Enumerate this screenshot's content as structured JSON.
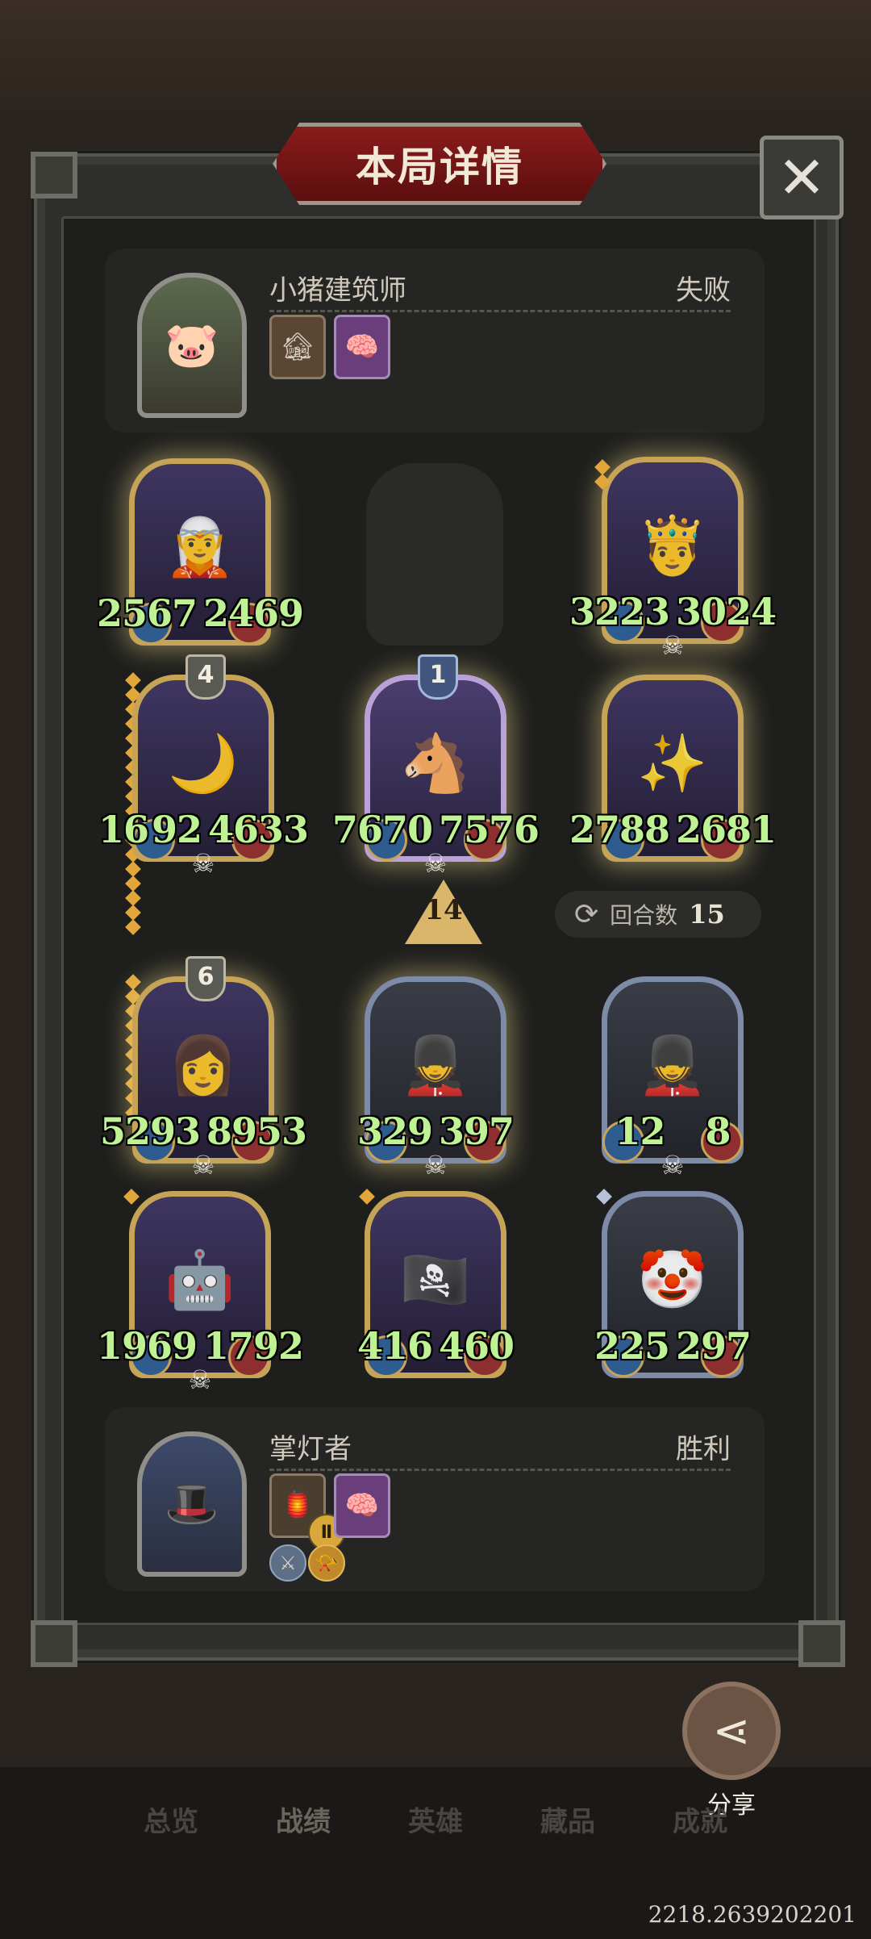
{
  "dialog": {
    "title": "本局详情",
    "close_label": "✕"
  },
  "opponent": {
    "name": "小猪建筑师",
    "result": "失败",
    "avatar_icon": "pig-builder-portrait"
  },
  "self": {
    "name": "掌灯者",
    "result": "胜利",
    "avatar_icon": "lamplighter-portrait"
  },
  "board": {
    "opponent_row": [
      {
        "attack": "2567",
        "health": "2469"
      },
      {
        "empty": true
      },
      {
        "attack": "3223",
        "health": "3024"
      }
    ],
    "opponent_front": [
      {
        "level": "4",
        "attack": "16",
        "hidden": "92",
        "health": "4633"
      },
      {
        "level": "1",
        "attack": "7670",
        "health": "7576"
      },
      {
        "attack": "2788",
        "health": "2681"
      }
    ],
    "player_front": [
      {
        "level": "6",
        "attack": "5293",
        "health": "8953"
      },
      {
        "attack": "329",
        "health": "397"
      },
      {
        "attack": "12",
        "health": "8"
      }
    ],
    "player_back": [
      {
        "attack": "1969",
        "health": "1792"
      },
      {
        "attack": "416",
        "health": "460"
      },
      {
        "attack": "225",
        "health": "297"
      }
    ]
  },
  "turn": {
    "label": "回合数",
    "count": "15"
  },
  "arrow_value": "14",
  "share": {
    "label": "分享"
  },
  "nav": [
    "总览",
    "战绩",
    "英雄",
    "藏品",
    "成就"
  ],
  "uid": "2218.2639202201",
  "colors": {
    "accent_gold": "#c5a357",
    "stat_green": "#bff294",
    "title_red": "#8a1c1c"
  }
}
